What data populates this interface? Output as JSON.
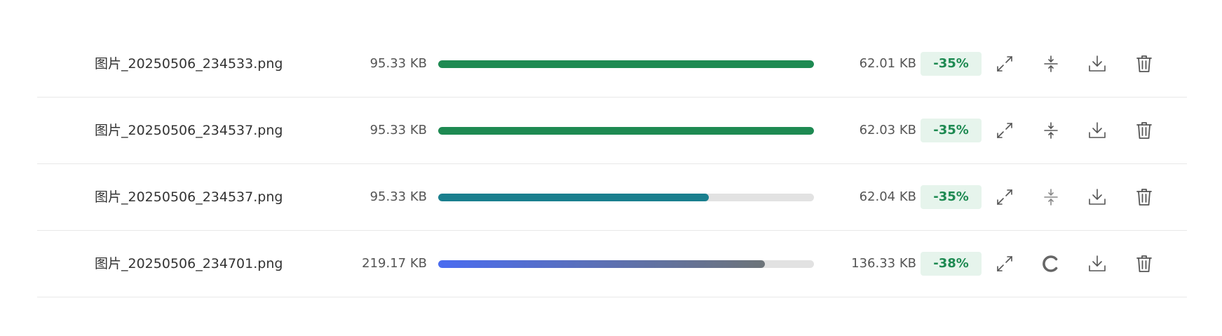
{
  "files": [
    {
      "name": "图片_20250506_234533.png",
      "original_size": "95.33 KB",
      "compressed_size": "62.01 KB",
      "reduction": "-35%",
      "progress": 1.0,
      "status": "done",
      "bar_color": "#1e8a52"
    },
    {
      "name": "图片_20250506_234537.png",
      "original_size": "95.33 KB",
      "compressed_size": "62.03 KB",
      "reduction": "-35%",
      "progress": 1.0,
      "status": "done",
      "bar_color": "#1e8a52"
    },
    {
      "name": "图片_20250506_234537.png",
      "original_size": "95.33 KB",
      "compressed_size": "62.04 KB",
      "reduction": "-35%",
      "progress": 0.72,
      "status": "in-progress",
      "bar_color": "#1a7f8e"
    },
    {
      "name": "图片_20250506_234701.png",
      "original_size": "219.17 KB",
      "compressed_size": "136.33 KB",
      "reduction": "-38%",
      "progress": 0.87,
      "status": "processing",
      "bar_gradient": [
        "#4a6cf0",
        "#6d7479"
      ]
    }
  ],
  "icons": {
    "expand": "expand-icon",
    "compress": "compress-icon",
    "download": "download-icon",
    "delete": "trash-icon",
    "loading": "loading-spinner-icon"
  },
  "colors": {
    "badge_text": "#1e8a52",
    "badge_bg": "#e6f4ec",
    "track": "#e2e2e2"
  }
}
